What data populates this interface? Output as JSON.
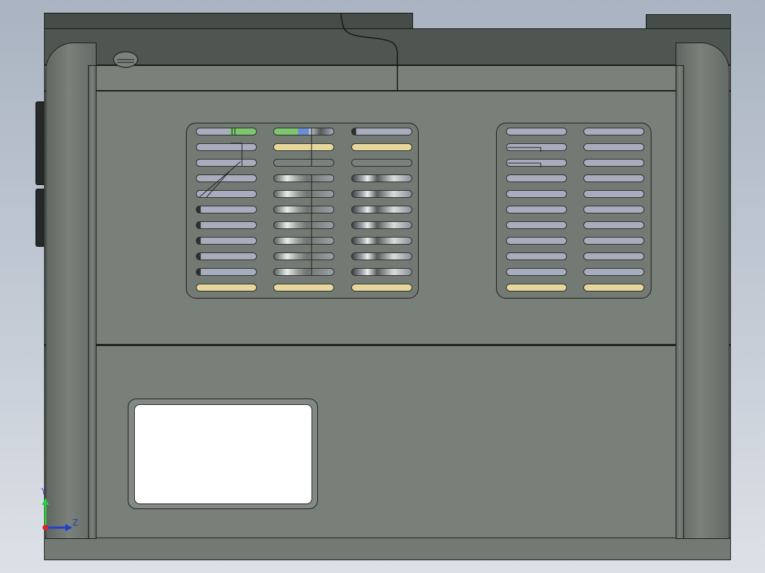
{
  "viewport": {
    "background_colors": [
      "#a9b3c1",
      "#dde1e7"
    ],
    "model_fill_color": "#79807a",
    "edge_color": "#1c1f1c"
  },
  "vents": {
    "left_grille": {
      "rows": 11,
      "columns": 3
    },
    "right_grille": {
      "rows": 11,
      "columns": 2
    },
    "accent_colors": {
      "slot": "#a7adbd",
      "highlight_yellow": "#e7d79c",
      "green": "#7ec56f",
      "blue": "#6b8fd6"
    }
  },
  "label_window": {
    "fill": "#ffffff"
  },
  "axis_triad": {
    "y_label": "Y",
    "z_label": "Z",
    "x_color": "#d8232a",
    "y_color": "#2ecc40",
    "z_color": "#1f3fcf"
  }
}
